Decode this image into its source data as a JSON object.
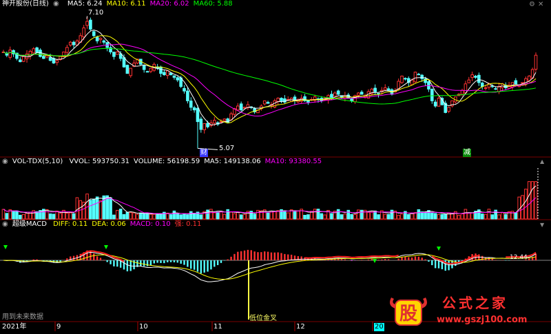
{
  "panels": {
    "price": {
      "title": "神开股份(日线)",
      "ma_items": [
        {
          "label": "MA5: 6.24",
          "color": "#ffffff"
        },
        {
          "label": "MA10: 6.11",
          "color": "#ffff00"
        },
        {
          "label": "MA20: 6.02",
          "color": "#ff00ff"
        },
        {
          "label": "MA60: 5.88",
          "color": "#00ff00"
        }
      ]
    },
    "volume": {
      "title": "VOL-TDX(5,10)",
      "items": [
        {
          "label": "VVOL: 593750.31",
          "color": "#ffffff"
        },
        {
          "label": "VOLUME: 56198.59",
          "color": "#ffffff"
        },
        {
          "label": "MA5: 149138.06",
          "color": "#ffffff"
        },
        {
          "label": "MA10: 93380.55",
          "color": "#ff00ff"
        }
      ]
    },
    "macd": {
      "title": "超级MACD",
      "items": [
        {
          "label": "DIFF: 0.11",
          "color": "#ffff00"
        },
        {
          "label": "DEA: 0.06",
          "color": "#ffff00"
        },
        {
          "label": "MACD: 0.10",
          "color": "#ff00ff"
        },
        {
          "label": "强: 0.11",
          "color": "#ff3030"
        }
      ]
    }
  },
  "annotations": {
    "high": "7.10",
    "low": "5.07",
    "cai_badge": "财",
    "jian_badge": "减",
    "low_golden": "低位金叉",
    "macd_label": "12.44",
    "bottom_left_text": "用到未来数据"
  },
  "x_axis": {
    "year": "2021年",
    "months": [
      "9",
      "10",
      "11",
      "12",
      "20"
    ]
  },
  "controls": {
    "settings": "⚙",
    "up": "▲",
    "down": "▼",
    "close": "✕"
  },
  "watermark": {
    "logo_char": "股",
    "site_name": "公式之家",
    "url": "www.gszj100.com"
  },
  "colors": {
    "up": "#ff3232",
    "down": "#54ffff",
    "ma5": "#ffffff",
    "ma10": "#ffff00",
    "ma20": "#ff00ff",
    "ma60": "#00ff00",
    "axis_red": "#b00000"
  },
  "chart_data": {
    "type": "candlestick",
    "x": [
      1,
      2,
      3,
      4,
      5,
      6,
      7,
      8,
      9,
      10,
      11,
      12,
      13,
      14,
      15,
      16,
      17,
      18,
      19,
      20,
      21,
      22,
      23,
      24,
      25,
      26,
      27,
      28,
      29,
      30,
      31,
      32,
      33,
      34,
      35,
      36,
      37,
      38,
      39,
      40,
      41,
      42,
      43,
      44,
      45,
      46,
      47,
      48,
      49,
      50,
      51,
      52,
      53,
      54,
      55,
      56,
      57,
      58,
      59,
      60,
      61,
      62,
      63,
      64,
      65,
      66,
      67,
      68,
      69,
      70,
      71,
      72,
      73,
      74,
      75,
      76,
      77,
      78,
      79,
      80,
      81,
      82,
      83,
      84,
      85,
      86,
      87,
      88,
      89,
      90,
      91,
      92,
      93,
      94,
      95,
      96,
      97,
      98,
      99,
      100,
      101,
      102,
      103,
      104,
      105,
      106,
      107,
      108,
      109,
      110,
      111,
      112,
      113,
      114,
      115,
      116,
      117,
      118,
      119,
      120,
      121,
      122,
      123,
      124,
      125,
      126,
      127,
      128,
      129,
      130,
      131,
      132,
      133,
      134,
      135,
      136,
      137,
      138,
      139,
      140,
      141,
      142,
      143,
      144,
      145,
      146,
      147,
      148,
      149,
      150,
      151,
      152,
      153,
      154,
      155,
      156,
      157,
      158,
      159,
      160
    ],
    "close": [
      6.55,
      6.5,
      6.58,
      6.52,
      6.45,
      6.4,
      6.48,
      6.52,
      6.56,
      6.6,
      6.54,
      6.48,
      6.45,
      6.5,
      6.42,
      6.38,
      6.42,
      6.48,
      6.55,
      6.62,
      6.7,
      6.66,
      6.72,
      6.8,
      6.92,
      7.02,
      6.9,
      6.8,
      6.72,
      6.76,
      6.7,
      6.62,
      6.55,
      6.48,
      6.55,
      6.45,
      6.32,
      6.22,
      6.3,
      6.38,
      6.44,
      6.36,
      6.28,
      6.24,
      6.3,
      6.36,
      6.3,
      6.22,
      6.2,
      6.26,
      6.2,
      6.16,
      6.12,
      6.02,
      5.95,
      5.8,
      5.7,
      5.66,
      5.48,
      5.36,
      5.45,
      5.4,
      5.46,
      5.5,
      5.44,
      5.48,
      5.52,
      5.47,
      5.6,
      5.68,
      5.72,
      5.66,
      5.7,
      5.74,
      5.7,
      5.63,
      5.66,
      5.72,
      5.8,
      5.76,
      5.74,
      5.8,
      5.84,
      5.8,
      5.78,
      5.82,
      5.84,
      5.8,
      5.82,
      5.84,
      5.8,
      5.78,
      5.82,
      5.86,
      5.82,
      5.8,
      5.84,
      5.88,
      5.84,
      5.92,
      5.9,
      5.85,
      5.88,
      5.84,
      5.8,
      5.88,
      5.92,
      5.9,
      5.88,
      5.94,
      5.98,
      5.94,
      5.9,
      5.96,
      6.0,
      5.96,
      5.9,
      5.96,
      6.1,
      6.18,
      6.14,
      6.08,
      6.12,
      6.24,
      6.2,
      6.14,
      6.08,
      5.98,
      5.8,
      5.72,
      5.84,
      5.74,
      5.62,
      5.7,
      5.8,
      5.86,
      5.9,
      5.96,
      6.06,
      6.12,
      6.2,
      6.16,
      6.08,
      6.02,
      6.0,
      6.06,
      6.02,
      5.98,
      6.02,
      6.06,
      6.0,
      6.04,
      6.08,
      6.06,
      6.04,
      6.08,
      6.14,
      6.18,
      6.28,
      6.5
    ],
    "low": 5.07,
    "high": 7.1,
    "ma_last": {
      "MA5": 6.24,
      "MA10": 6.11,
      "MA20": 6.02,
      "MA60": 5.88
    },
    "volume_last": {
      "VVOL": 593750.31,
      "VOLUME": 56198.59,
      "MA5": 149138.06,
      "MA10": 93380.55
    },
    "macd_last": {
      "DIFF": 0.11,
      "DEA": 0.06,
      "MACD": 0.1,
      "强": 0.11
    }
  }
}
